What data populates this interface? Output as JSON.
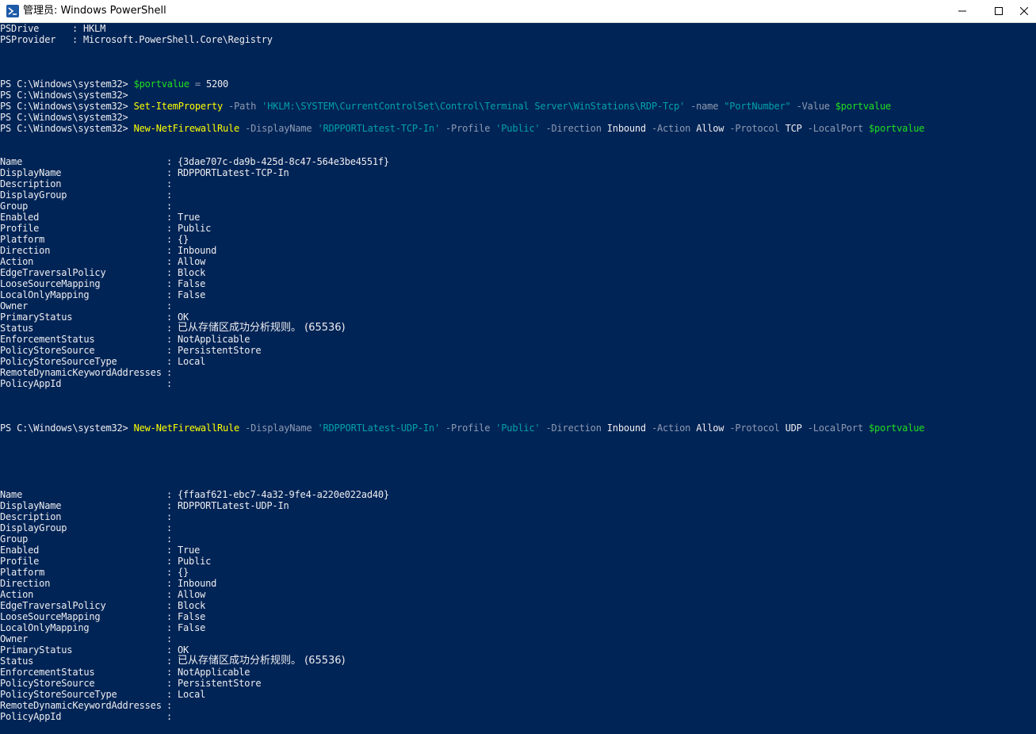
{
  "window": {
    "title": "管理员: Windows PowerShell"
  },
  "colors": {
    "console_bg": "#012456",
    "text": "#eeedf0",
    "command": "#ffff00",
    "parameter": "#8f9bb3",
    "string": "#00a2a7",
    "variable": "#20e020"
  },
  "icons": {
    "app": "powershell-icon",
    "minimize": "minimize-icon",
    "maximize": "maximize-icon",
    "close": "close-icon"
  },
  "pre_output": [
    {
      "name": "PSDrive",
      "value": "HKLM"
    },
    {
      "name": "PSProvider",
      "value": "Microsoft.PowerShell.Core\\Registry"
    }
  ],
  "prompt": "PS C:\\Windows\\system32>",
  "commands": {
    "set_port": {
      "variable": "$portvalue",
      "operator": "=",
      "value": "5200"
    },
    "set_item": {
      "cmdlet": "Set-ItemProperty",
      "p_path": "-Path",
      "path": "'HKLM:\\SYSTEM\\CurrentControlSet\\Control\\Terminal Server\\WinStations\\RDP-Tcp'",
      "p_name": "-name",
      "name": "\"PortNumber\"",
      "p_value": "-Value",
      "variable": "$portvalue"
    },
    "fw_tcp": {
      "cmdlet": "New-NetFirewallRule",
      "p_display": "-DisplayName",
      "display": "'RDPPORTLatest-TCP-In'",
      "p_profile": "-Profile",
      "profile": "'Public'",
      "p_direction": "-Direction",
      "direction": "Inbound",
      "p_action": "-Action",
      "action": "Allow",
      "p_protocol": "-Protocol",
      "protocol": "TCP",
      "p_localport": "-LocalPort",
      "variable": "$portvalue"
    },
    "fw_udp": {
      "cmdlet": "New-NetFirewallRule",
      "p_display": "-DisplayName",
      "display": "'RDPPORTLatest-UDP-In'",
      "p_profile": "-Profile",
      "profile": "'Public'",
      "p_direction": "-Direction",
      "direction": "Inbound",
      "p_action": "-Action",
      "action": "Allow",
      "p_protocol": "-Protocol",
      "protocol": "UDP",
      "p_localport": "-LocalPort",
      "variable": "$portvalue"
    }
  },
  "separator": ":",
  "rule_tcp": [
    {
      "name": "Name",
      "value": "{3dae707c-da9b-425d-8c47-564e3be4551f}"
    },
    {
      "name": "DisplayName",
      "value": "RDPPORTLatest-TCP-In"
    },
    {
      "name": "Description",
      "value": ""
    },
    {
      "name": "DisplayGroup",
      "value": ""
    },
    {
      "name": "Group",
      "value": ""
    },
    {
      "name": "Enabled",
      "value": "True"
    },
    {
      "name": "Profile",
      "value": "Public"
    },
    {
      "name": "Platform",
      "value": "{}"
    },
    {
      "name": "Direction",
      "value": "Inbound"
    },
    {
      "name": "Action",
      "value": "Allow"
    },
    {
      "name": "EdgeTraversalPolicy",
      "value": "Block"
    },
    {
      "name": "LooseSourceMapping",
      "value": "False"
    },
    {
      "name": "LocalOnlyMapping",
      "value": "False"
    },
    {
      "name": "Owner",
      "value": ""
    },
    {
      "name": "PrimaryStatus",
      "value": "OK"
    },
    {
      "name": "Status",
      "value": "已从存储区成功分析规则。 (65536)"
    },
    {
      "name": "EnforcementStatus",
      "value": "NotApplicable"
    },
    {
      "name": "PolicyStoreSource",
      "value": "PersistentStore"
    },
    {
      "name": "PolicyStoreSourceType",
      "value": "Local"
    },
    {
      "name": "RemoteDynamicKeywordAddresses",
      "value": ""
    },
    {
      "name": "PolicyAppId",
      "value": ""
    }
  ],
  "rule_udp": [
    {
      "name": "Name",
      "value": "{ffaaf621-ebc7-4a32-9fe4-a220e022ad40}"
    },
    {
      "name": "DisplayName",
      "value": "RDPPORTLatest-UDP-In"
    },
    {
      "name": "Description",
      "value": ""
    },
    {
      "name": "DisplayGroup",
      "value": ""
    },
    {
      "name": "Group",
      "value": ""
    },
    {
      "name": "Enabled",
      "value": "True"
    },
    {
      "name": "Profile",
      "value": "Public"
    },
    {
      "name": "Platform",
      "value": "{}"
    },
    {
      "name": "Direction",
      "value": "Inbound"
    },
    {
      "name": "Action",
      "value": "Allow"
    },
    {
      "name": "EdgeTraversalPolicy",
      "value": "Block"
    },
    {
      "name": "LooseSourceMapping",
      "value": "False"
    },
    {
      "name": "LocalOnlyMapping",
      "value": "False"
    },
    {
      "name": "Owner",
      "value": ""
    },
    {
      "name": "PrimaryStatus",
      "value": "OK"
    },
    {
      "name": "Status",
      "value": "已从存储区成功分析规则。 (65536)"
    },
    {
      "name": "EnforcementStatus",
      "value": "NotApplicable"
    },
    {
      "name": "PolicyStoreSource",
      "value": "PersistentStore"
    },
    {
      "name": "PolicyStoreSourceType",
      "value": "Local"
    },
    {
      "name": "RemoteDynamicKeywordAddresses",
      "value": ""
    },
    {
      "name": "PolicyAppId",
      "value": ""
    }
  ]
}
